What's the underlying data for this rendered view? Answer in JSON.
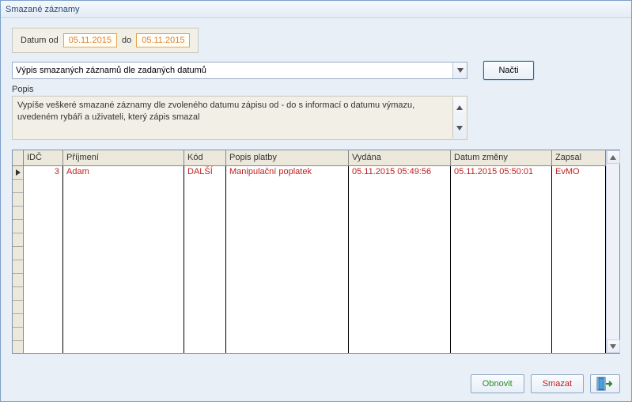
{
  "window": {
    "title": "Smazané záznamy"
  },
  "dates": {
    "from_label": "Datum od",
    "from_value": "05.11.2015",
    "to_label": "do",
    "to_value": "05.11.2015"
  },
  "selector": {
    "value": "Výpis smazaných záznamů dle zadaných datumů"
  },
  "buttons": {
    "load": "Načti",
    "refresh": "Obnovit",
    "delete": "Smazat"
  },
  "description": {
    "label": "Popis",
    "text": "Vypíše veškeré smazané záznamy dle zvoleného datumu zápisu od - do s informací o datumu výmazu, uvedeném rybáři a uživateli, který zápis smazal"
  },
  "grid": {
    "headers": [
      "IDČ",
      "Příjmení",
      "Kód",
      "Popis platby",
      "Vydána",
      "Datum změny",
      "Zapsal"
    ],
    "rows": [
      {
        "id": "3",
        "prijmeni": "Adam",
        "kod": "DALŠÍ",
        "popis": "Manipulační poplatek",
        "vydana": "05.11.2015 05:49:56",
        "datum_zmeny": "05.11.2015 05:50:01",
        "zapsal": "EvMO"
      }
    ]
  }
}
